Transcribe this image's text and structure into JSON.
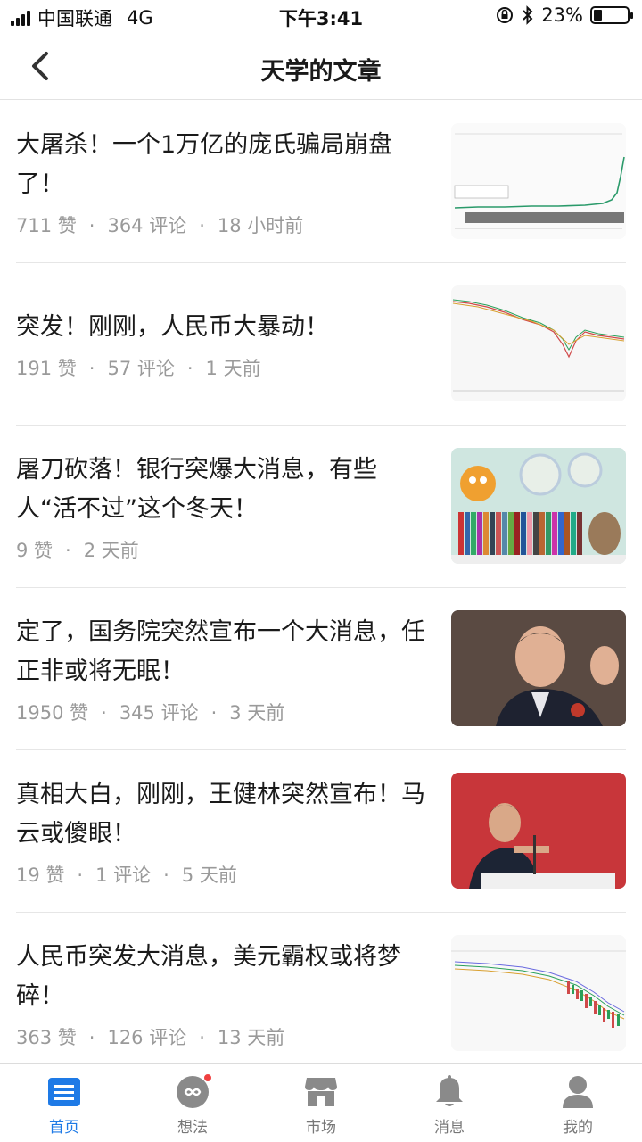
{
  "status_bar": {
    "carrier": "中国联通",
    "network": "4G",
    "time": "下午3:41",
    "battery": "23%",
    "battery_level": 0.23
  },
  "header": {
    "title": "天学的文章",
    "back_icon": "chevron-left-icon"
  },
  "articles": [
    {
      "title": "大屠杀！一个1万亿的庞氏骗局崩盘了！",
      "likes": "711 赞",
      "comments": "364 评论",
      "time": "18 小时前",
      "thumbnail": "price-chart-surge"
    },
    {
      "title": "突发！刚刚，人民币大暴动！",
      "likes": "191 赞",
      "comments": "57 评论",
      "time": "1 天前",
      "thumbnail": "candlestick-chart"
    },
    {
      "title": "屠刀砍落！银行突爆大消息，有些人“活不过”这个冬天！",
      "likes": "9 赞",
      "comments": "",
      "time": "2 天前",
      "thumbnail": "bookshelf-cartoon"
    },
    {
      "title": "定了，国务院突然宣布一个大消息，任正非或将无眠！",
      "likes": "1950 赞",
      "comments": "345 评论",
      "time": "3 天前",
      "thumbnail": "man-portrait"
    },
    {
      "title": "真相大白，刚刚，王健林突然宣布！马云或傻眼！",
      "likes": "19 赞",
      "comments": "1 评论",
      "time": "5 天前",
      "thumbnail": "speaker-podium"
    },
    {
      "title": "人民币突发大消息，美元霸权或将梦碎！",
      "likes": "363 赞",
      "comments": "126 评论",
      "time": "13 天前",
      "thumbnail": "candlestick-chart-2"
    }
  ],
  "tab_bar": {
    "tabs": [
      {
        "label": "首页",
        "icon": "home-doc-icon",
        "active": true
      },
      {
        "label": "想法",
        "icon": "ideas-icon",
        "badge": true
      },
      {
        "label": "市场",
        "icon": "store-icon"
      },
      {
        "label": "消息",
        "icon": "bell-icon"
      },
      {
        "label": "我的",
        "icon": "person-icon"
      }
    ]
  },
  "colors": {
    "accent": "#1e7ae6",
    "badge": "#f04040",
    "meta_text": "#9a9a9a"
  }
}
